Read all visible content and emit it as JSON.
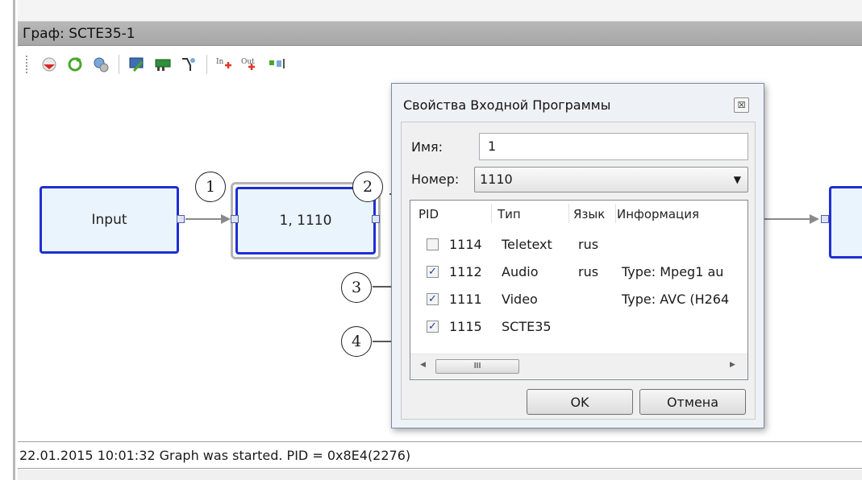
{
  "graph_panel": {
    "title": "Граф: SCTE35-1"
  },
  "toolbar": {
    "icons": [
      "import-graph-icon",
      "refresh-icon",
      "settings-icon",
      "monitor-icon",
      "network-card-icon",
      "filter-icon",
      "add-input-icon",
      "add-output-icon",
      "add-block-icon"
    ],
    "in_label": "In",
    "out_label": "Out"
  },
  "nodes": {
    "input": "Input",
    "program": "1, 1110"
  },
  "callouts": [
    "1",
    "2",
    "3",
    "4"
  ],
  "dialog": {
    "title": "Свойства Входной Программы",
    "close": "☒",
    "name_label": "Имя:",
    "name_value": "1",
    "number_label": "Номер:",
    "number_value": "1110",
    "columns": [
      "PID",
      "Тип",
      "Язык",
      "Информация"
    ],
    "rows": [
      {
        "checked": false,
        "pid": "1114",
        "type": "Teletext",
        "lang": "rus",
        "info": ""
      },
      {
        "checked": true,
        "pid": "1112",
        "type": "Audio",
        "lang": "rus",
        "info": "Type: Mpeg1 au"
      },
      {
        "checked": true,
        "pid": "1111",
        "type": "Video",
        "lang": "",
        "info": "Type: AVC (H264"
      },
      {
        "checked": true,
        "pid": "1115",
        "type": "SCTE35",
        "lang": "",
        "info": ""
      }
    ],
    "scroll_thumb": "III",
    "ok": "OK",
    "cancel": "Отмена"
  },
  "status": {
    "text": "22.01.2015 10:01:32 Graph was started. PID = 0x8E4(2276)"
  },
  "colors": {
    "node_border": "#1f2fd1",
    "node_fill": "#eaf4fd",
    "title_bar": "#acacac"
  }
}
